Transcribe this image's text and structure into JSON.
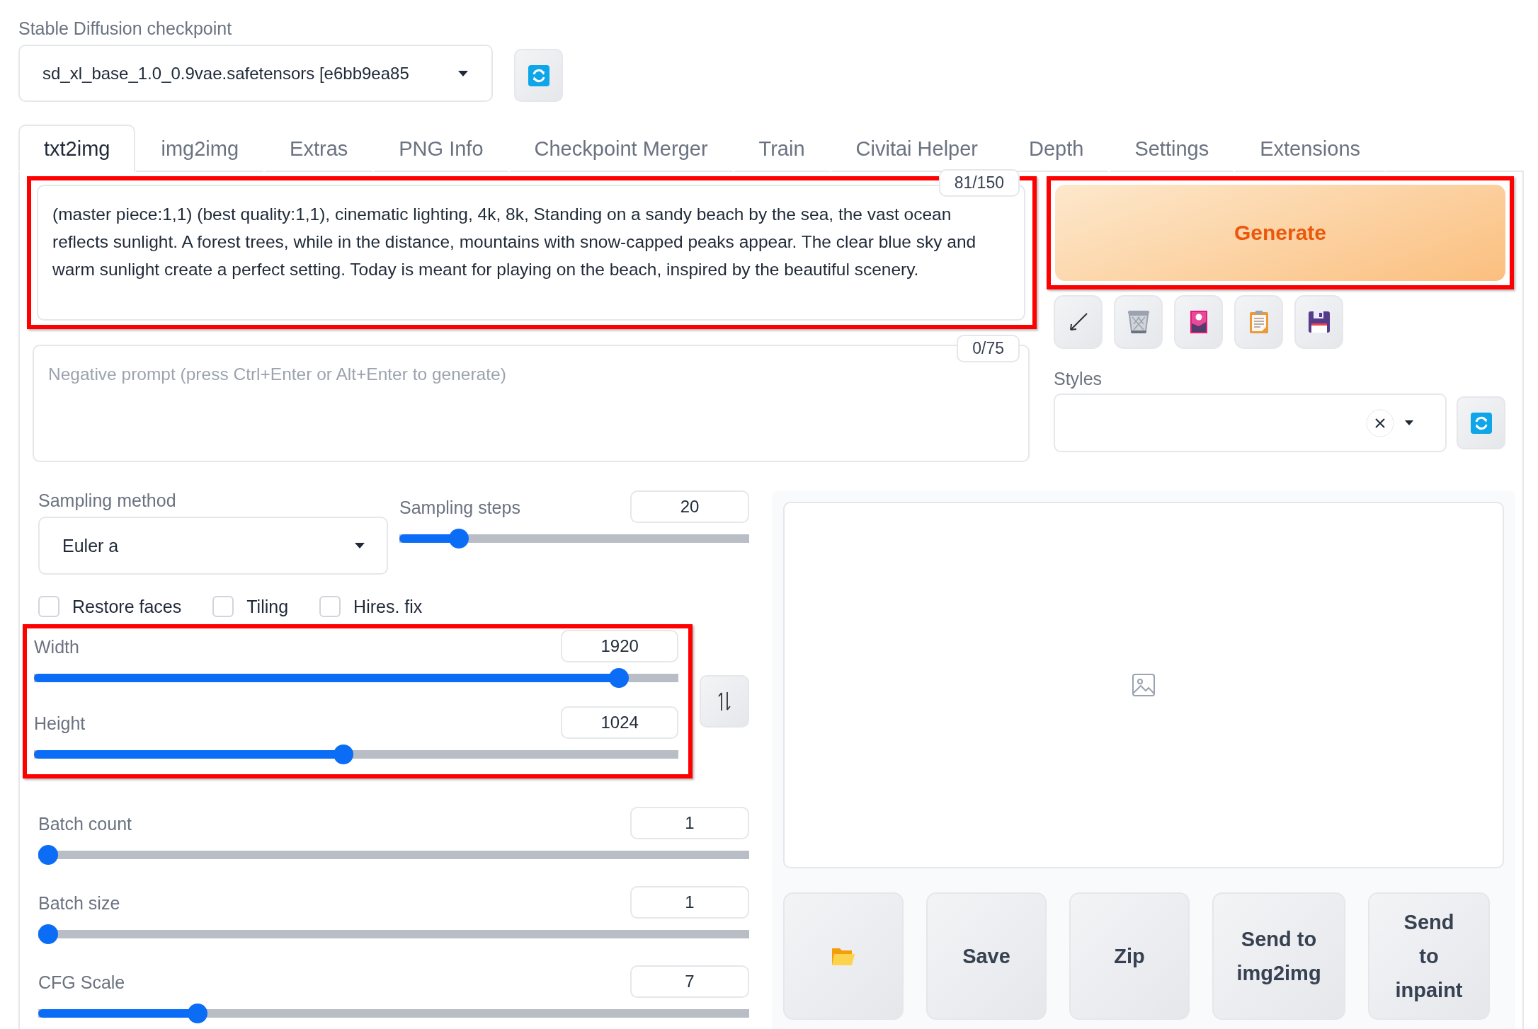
{
  "checkpoint": {
    "label": "Stable Diffusion checkpoint",
    "value": "sd_xl_base_1.0_0.9vae.safetensors [e6bb9ea85"
  },
  "tabs": [
    {
      "label": "txt2img",
      "selected": true
    },
    {
      "label": "img2img",
      "selected": false
    },
    {
      "label": "Extras",
      "selected": false
    },
    {
      "label": "PNG Info",
      "selected": false
    },
    {
      "label": "Checkpoint Merger",
      "selected": false
    },
    {
      "label": "Train",
      "selected": false
    },
    {
      "label": "Civitai Helper",
      "selected": false
    },
    {
      "label": "Depth",
      "selected": false
    },
    {
      "label": "Settings",
      "selected": false
    },
    {
      "label": "Extensions",
      "selected": false
    }
  ],
  "prompt": {
    "value": "(master piece:1,1) (best quality:1,1), cinematic lighting, 4k, 8k, Standing on a sandy beach by the sea, the vast ocean reflects sunlight. A forest trees, while in the distance, mountains with snow-capped peaks appear. The clear blue sky and warm sunlight create a perfect setting.  Today is meant for playing on the beach, inspired by the beautiful scenery.",
    "counter": "81/150",
    "highlighted": true
  },
  "negative_prompt": {
    "placeholder": "Negative prompt (press Ctrl+Enter or Alt+Enter to generate)",
    "counter": "0/75"
  },
  "generate": {
    "label": "Generate",
    "highlighted": true
  },
  "styles": {
    "label": "Styles"
  },
  "sampling_method": {
    "label": "Sampling method",
    "value": "Euler a"
  },
  "sampling_steps": {
    "label": "Sampling steps",
    "value": "20",
    "level": 0.15
  },
  "checkboxes": [
    {
      "label": "Restore faces",
      "checked": false
    },
    {
      "label": "Tiling",
      "checked": false
    },
    {
      "label": "Hires. fix",
      "checked": false
    }
  ],
  "dimensions": {
    "highlighted": true,
    "sliders": [
      {
        "label": "Width",
        "value": "1920",
        "level": 0.92
      },
      {
        "label": "Height",
        "value": "1024",
        "level": 0.48
      }
    ]
  },
  "batch_sliders": [
    {
      "label": "Batch count",
      "value": "1",
      "level": 0
    },
    {
      "label": "Batch size",
      "value": "1",
      "level": 0
    },
    {
      "label": "CFG Scale",
      "value": "7",
      "level": 0.216
    }
  ],
  "output_buttons": [
    {
      "kind": "folder"
    },
    {
      "kind": "text",
      "label": "Save"
    },
    {
      "kind": "text",
      "label": "Zip"
    },
    {
      "kind": "text",
      "label": "Send to img2img"
    },
    {
      "kind": "text",
      "label": "Send to inpaint"
    }
  ]
}
